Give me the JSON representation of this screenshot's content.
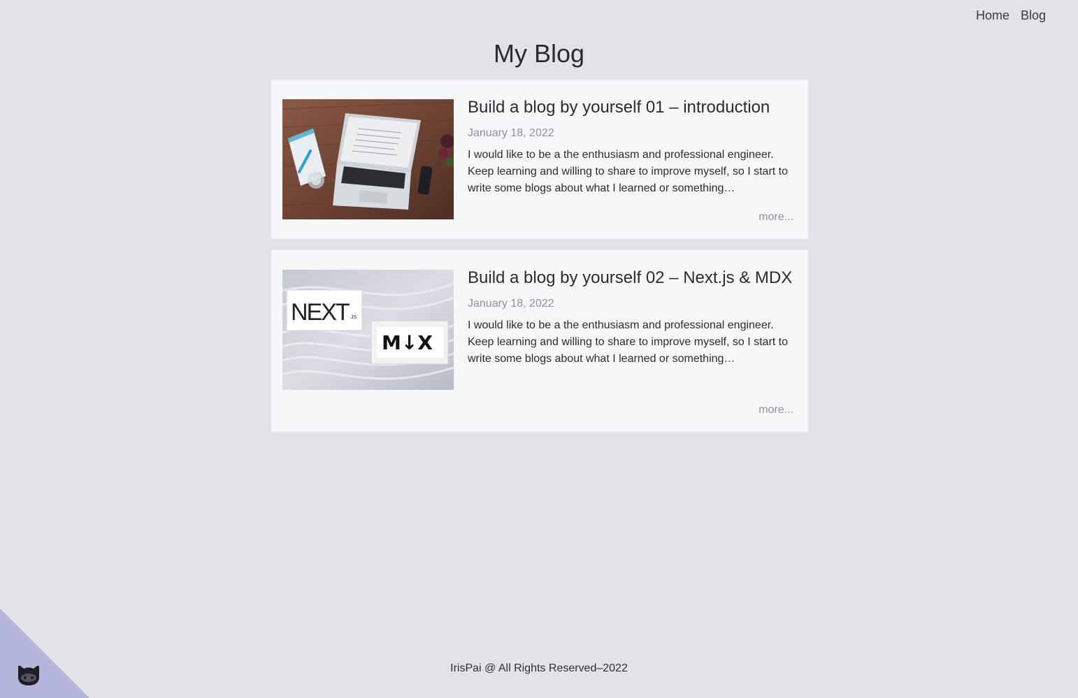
{
  "nav": {
    "home": "Home",
    "blog": "Blog"
  },
  "page": {
    "title": "My Blog"
  },
  "posts": [
    {
      "title": "Build a blog by yourself 01 – introduction",
      "date": "January 18, 2022",
      "excerpt": "I would like to be a the enthusiasm and professional engineer. Keep learning and willing to share to improve myself, so I start to write some blogs about what I learned or something…",
      "more": "more...",
      "thumbnail_icon": "laptop-desk-photo"
    },
    {
      "title": "Build a blog by yourself 02 – Next.js & MDX",
      "date": "January 18, 2022",
      "excerpt": "I would like to be a the enthusiasm and professional engineer. Keep learning and willing to share to improve myself, so I start to write some blogs about what I learned or something…",
      "more": "more...",
      "thumbnail_icon": "nextjs-mdx-logos",
      "thumbnail_text": {
        "next": "NEXT",
        "js": ".JS",
        "mdx": "M↓X"
      }
    }
  ],
  "footer": {
    "text": "IrisPai @ All Rights Reserved–2022"
  },
  "corner": {
    "icon": "github-octocat-icon",
    "color": "#b4b5da"
  }
}
